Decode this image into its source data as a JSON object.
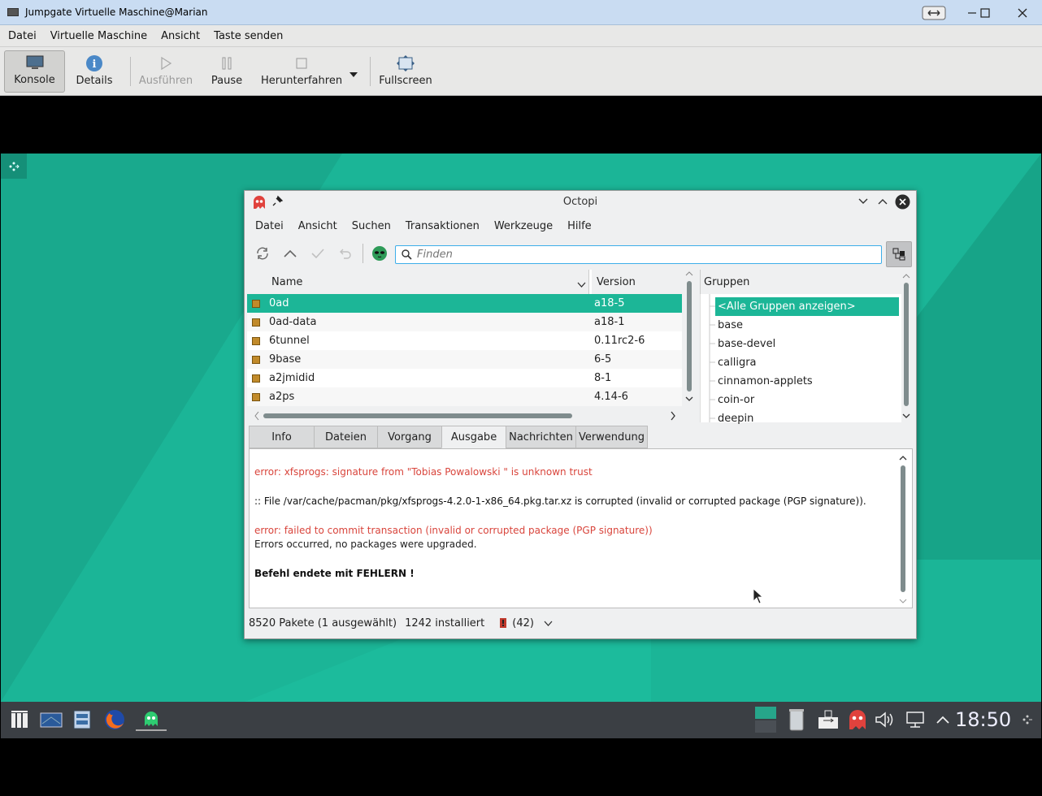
{
  "window": {
    "title": "Jumpgate Virtuelle Maschine@Marian"
  },
  "menubar": [
    "Datei",
    "Virtuelle Maschine",
    "Ansicht",
    "Taste senden"
  ],
  "toolbar": {
    "konsole": "Konsole",
    "details": "Details",
    "ausfuehren": "Ausführen",
    "pause": "Pause",
    "herunterfahren": "Herunterfahren",
    "fullscreen": "Fullscreen"
  },
  "octopi": {
    "title": "Octopi",
    "menu": [
      "Datei",
      "Ansicht",
      "Suchen",
      "Transaktionen",
      "Werkzeuge",
      "Hilfe"
    ],
    "search_placeholder": "Finden",
    "columns": {
      "name": "Name",
      "version": "Version"
    },
    "packages": [
      {
        "name": "0ad",
        "version": "a18-5"
      },
      {
        "name": "0ad-data",
        "version": "a18-1"
      },
      {
        "name": "6tunnel",
        "version": "0.11rc2-6"
      },
      {
        "name": "9base",
        "version": "6-5"
      },
      {
        "name": "a2jmidid",
        "version": "8-1"
      },
      {
        "name": "a2ps",
        "version": "4.14-6"
      }
    ],
    "groups_header": "Gruppen",
    "groups": [
      "<Alle Gruppen anzeigen>",
      "base",
      "base-devel",
      "calligra",
      "cinnamon-applets",
      "coin-or",
      "deepin"
    ],
    "tabs": [
      "Info",
      "Dateien",
      "Vorgang",
      "Ausgabe",
      "Nachrichten",
      "Verwendung"
    ],
    "active_tab": "Ausgabe",
    "output": {
      "line1": "error: xfsprogs: signature from \"Tobias Powalowski \" is unknown trust",
      "line2": ":: File /var/cache/pacman/pkg/xfsprogs-4.2.0-1-x86_64.pkg.tar.xz is corrupted (invalid or corrupted package (PGP signature)).",
      "line3": "error: failed to commit transaction (invalid or corrupted package (PGP signature))",
      "line4": "Errors occurred, no packages were upgraded.",
      "line5": "Befehl endete mit FEHLERN !"
    },
    "status": {
      "packages": "8520 Pakete (1 ausgewählt)",
      "installed": "1242 installiert",
      "updates": "(42)"
    }
  },
  "taskbar": {
    "clock": "18:50"
  },
  "colors": {
    "accent": "#1cb697",
    "error": "#d9453c",
    "desktop": "#1bb597"
  }
}
